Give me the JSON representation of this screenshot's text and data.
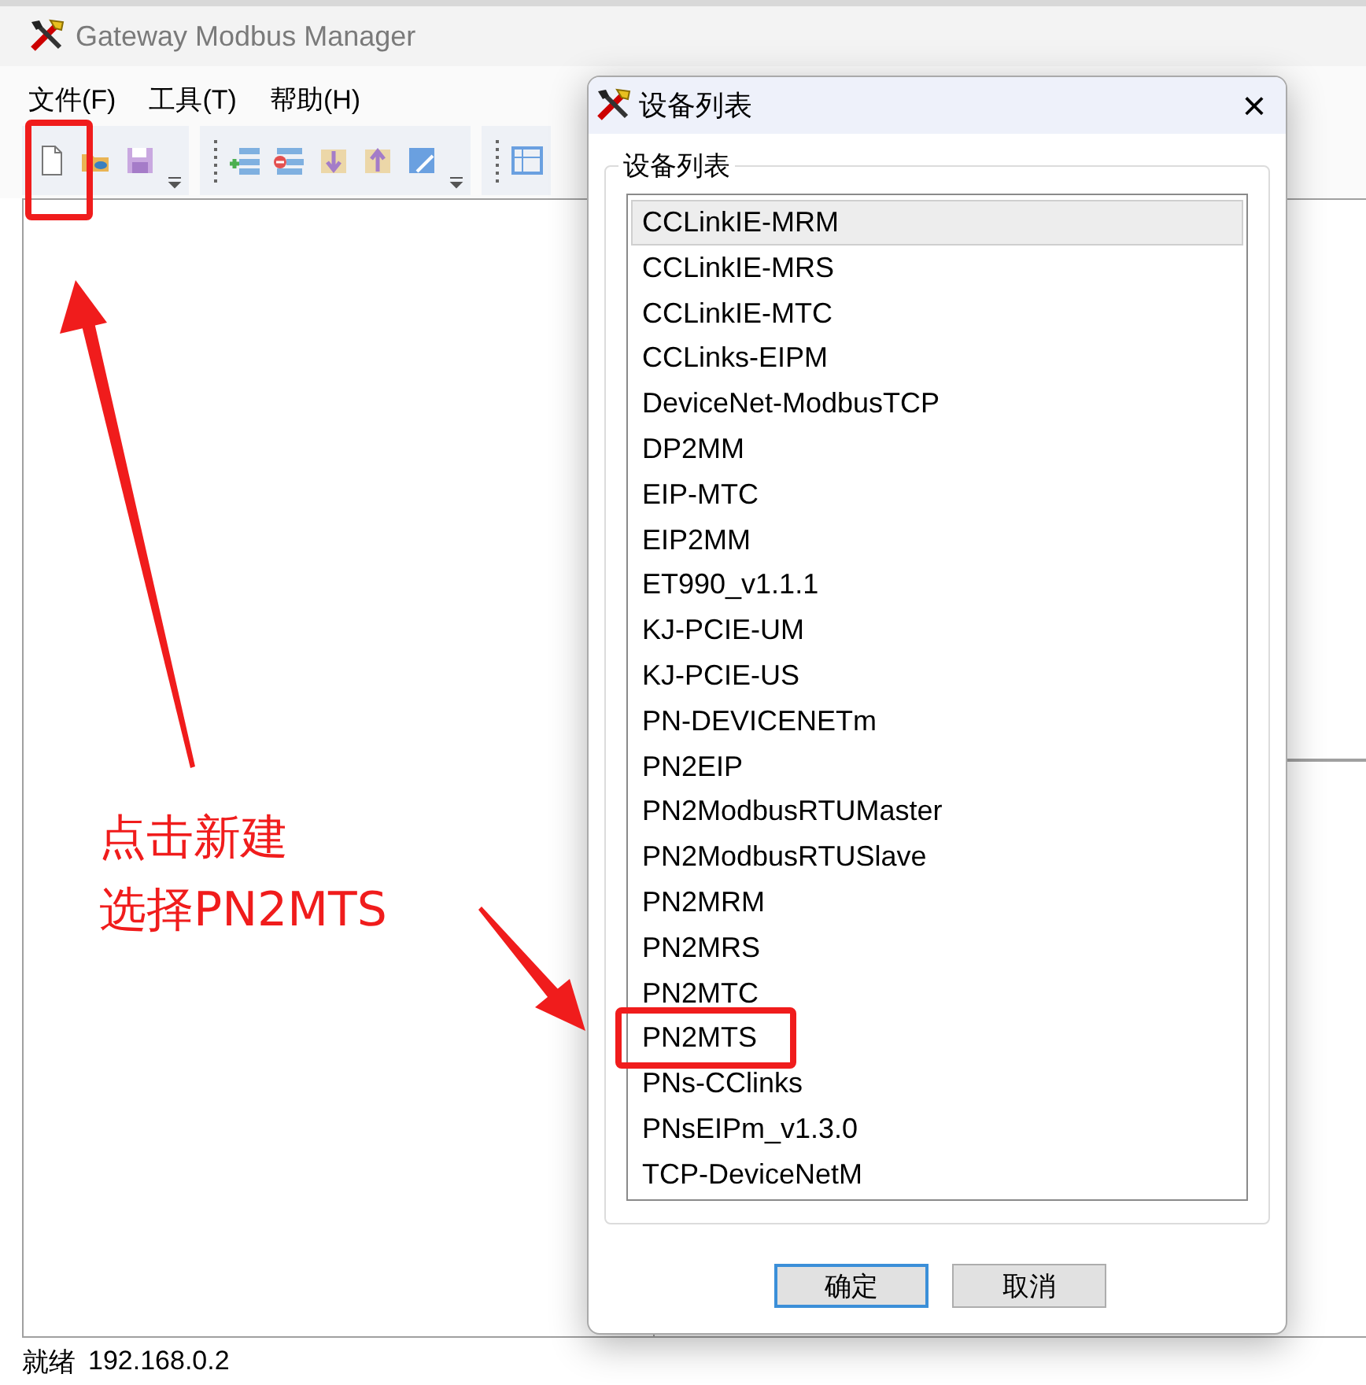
{
  "window": {
    "title": "Gateway Modbus Manager"
  },
  "menu": [
    {
      "label": "文件(F)"
    },
    {
      "label": "工具(T)"
    },
    {
      "label": "帮助(H)"
    }
  ],
  "dialog": {
    "title": "设备列表",
    "close": "×",
    "group_label": "设备列表",
    "devices": [
      {
        "label": "CCLinkIE-MRM",
        "selected": true,
        "circled": false
      },
      {
        "label": "CCLinkIE-MRS",
        "selected": false,
        "circled": false
      },
      {
        "label": "CCLinkIE-MTC",
        "selected": false,
        "circled": false
      },
      {
        "label": "CCLinks-EIPM",
        "selected": false,
        "circled": false
      },
      {
        "label": "DeviceNet-ModbusTCP",
        "selected": false,
        "circled": false
      },
      {
        "label": "DP2MM",
        "selected": false,
        "circled": false
      },
      {
        "label": "EIP-MTC",
        "selected": false,
        "circled": false
      },
      {
        "label": "EIP2MM",
        "selected": false,
        "circled": false
      },
      {
        "label": "ET990_v1.1.1",
        "selected": false,
        "circled": false
      },
      {
        "label": "KJ-PCIE-UM",
        "selected": false,
        "circled": false
      },
      {
        "label": "KJ-PCIE-US",
        "selected": false,
        "circled": false
      },
      {
        "label": "PN-DEVICENETm",
        "selected": false,
        "circled": false
      },
      {
        "label": "PN2EIP",
        "selected": false,
        "circled": false
      },
      {
        "label": "PN2ModbusRTUMaster",
        "selected": false,
        "circled": false
      },
      {
        "label": "PN2ModbusRTUSlave",
        "selected": false,
        "circled": false
      },
      {
        "label": "PN2MRM",
        "selected": false,
        "circled": false
      },
      {
        "label": "PN2MRS",
        "selected": false,
        "circled": false
      },
      {
        "label": "PN2MTC",
        "selected": false,
        "circled": false
      },
      {
        "label": "PN2MTS",
        "selected": false,
        "circled": true
      },
      {
        "label": "PNs-CClinks",
        "selected": false,
        "circled": false
      },
      {
        "label": "PNsEIPm_v1.3.0",
        "selected": false,
        "circled": false
      },
      {
        "label": "TCP-DeviceNetM",
        "selected": false,
        "circled": false
      }
    ],
    "buttons": [
      {
        "label": "确定",
        "default": true
      },
      {
        "label": "取消",
        "default": false
      }
    ]
  },
  "status_bar": {
    "status": "就绪",
    "ip": "192.168.0.2"
  },
  "annotation": {
    "lines": [
      "点击新建",
      "选择PN2MTS"
    ]
  }
}
